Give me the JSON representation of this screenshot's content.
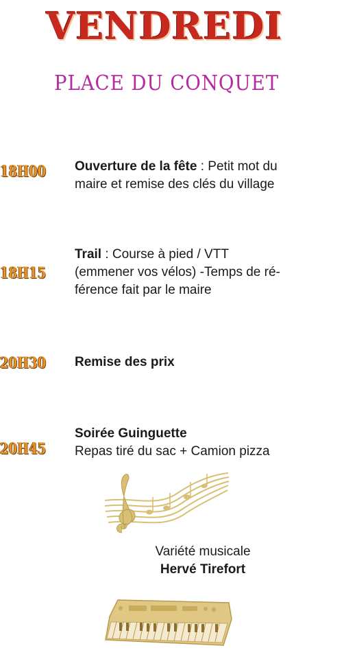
{
  "header": {
    "day": "VENDREDI",
    "location": "PLACE DU CONQUET"
  },
  "schedule": [
    {
      "time": "18H00",
      "title": "Ouverture de la fête",
      "separator": " : ",
      "desc_lines": [
        "Petit mot du",
        "maire et remise des clés du village"
      ]
    },
    {
      "time": "18H15",
      "title": "Trail",
      "separator": " : ",
      "desc_lines": [
        "Course à pied / VTT",
        "(emmener vos vélos) -Temps de ré-",
        "férence fait par le maire"
      ]
    },
    {
      "time": "20H30",
      "title": "Remise des prix",
      "separator": "",
      "desc_lines": []
    },
    {
      "time": "20H45",
      "title": "Soirée Guinguette",
      "separator": "",
      "desc_lines": [
        "Repas tiré du sac + Camion pizza"
      ]
    }
  ],
  "music": {
    "label": "Variété musicale",
    "artist": "Hervé Tirefort"
  },
  "colors": {
    "title_red": "#c8291f",
    "subtitle_magenta": "#b52aa0",
    "time_orange": "#e7952a",
    "gold_illustration": "#d9bf73"
  },
  "icons": [
    "musical-staff-treble-clef-icon",
    "keyboard-synthesizer-icon"
  ]
}
